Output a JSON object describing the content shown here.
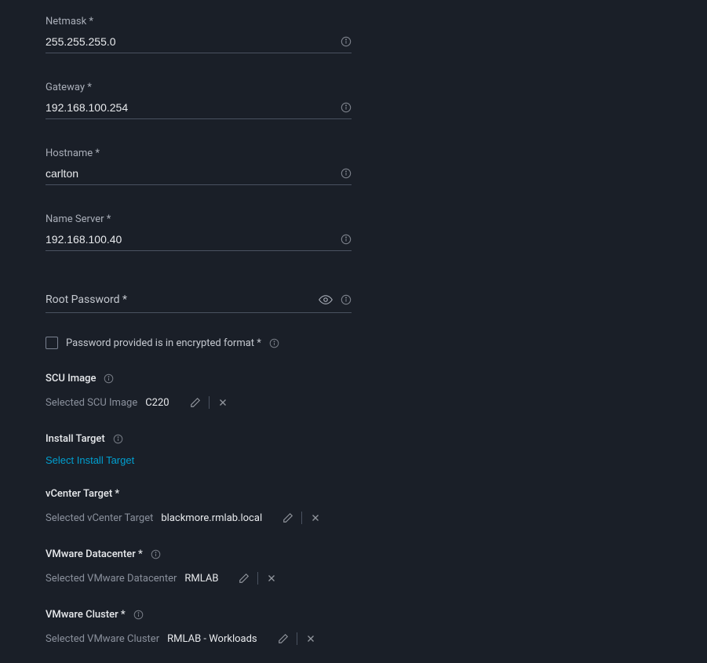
{
  "fields": {
    "netmask": {
      "label": "Netmask *",
      "value": "255.255.255.0"
    },
    "gateway": {
      "label": "Gateway *",
      "value": "192.168.100.254"
    },
    "hostname": {
      "label": "Hostname *",
      "value": "carlton"
    },
    "nameserver": {
      "label": "Name Server *",
      "value": "192.168.100.40"
    },
    "rootpassword": {
      "label": "Root Password *",
      "value": ""
    }
  },
  "checkbox": {
    "encrypted_label": "Password provided is in encrypted format *"
  },
  "scu": {
    "header": "SCU Image",
    "selected_label": "Selected SCU Image",
    "selected_value": "C220"
  },
  "install_target": {
    "header": "Install Target",
    "link": "Select Install Target"
  },
  "vcenter": {
    "header": "vCenter Target *",
    "selected_label": "Selected vCenter Target",
    "selected_value": "blackmore.rmlab.local"
  },
  "datacenter": {
    "header": "VMware Datacenter *",
    "selected_label": "Selected VMware Datacenter",
    "selected_value": "RMLAB"
  },
  "cluster": {
    "header": "VMware Cluster *",
    "selected_label": "Selected VMware Cluster",
    "selected_value": "RMLAB - Workloads"
  }
}
